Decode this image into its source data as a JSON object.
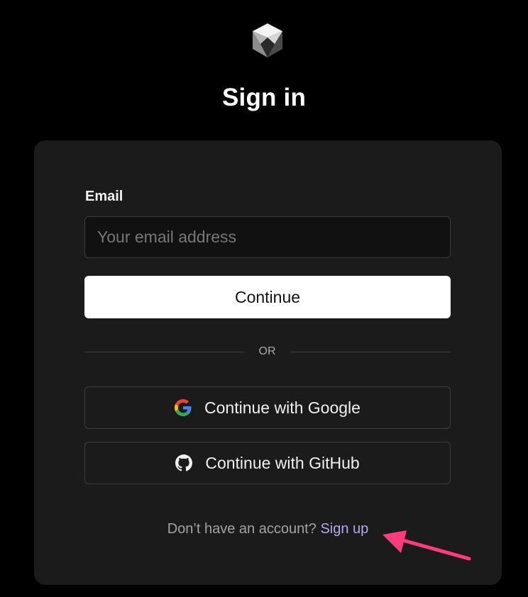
{
  "app": {
    "logo_name": "cube-logo",
    "title": "Sign in"
  },
  "form": {
    "email_label": "Email",
    "email_placeholder": "Your email address",
    "email_value": "",
    "continue_label": "Continue",
    "divider_text": "OR"
  },
  "oauth": {
    "google_label": "Continue with Google",
    "google_icon": "google-icon",
    "github_label": "Continue with GitHub",
    "github_icon": "github-icon"
  },
  "footer": {
    "prompt_text": "Don’t have an account?",
    "signup_label": "Sign up"
  },
  "annotation": {
    "arrow_icon": "arrow-icon",
    "arrow_color": "#ff3b7f"
  },
  "colors": {
    "background": "#000000",
    "card": "#1b1b1b",
    "link": "#b8a6f0",
    "primary_button": "#ffffff"
  }
}
